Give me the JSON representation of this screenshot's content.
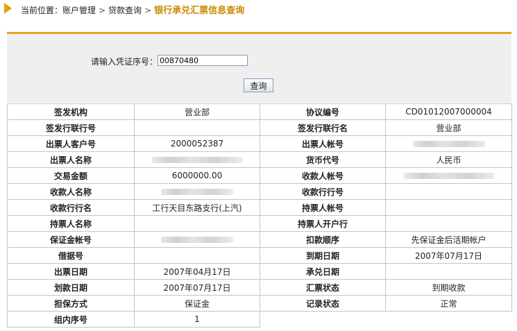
{
  "breadcrumb": {
    "prefix": "当前位置：",
    "items": [
      "账户管理",
      "贷款查询"
    ],
    "current": "银行承兑汇票信息查询",
    "separator": ">"
  },
  "search": {
    "label": "请输入凭证序号：",
    "value": "00870480",
    "button": "查询"
  },
  "rows": [
    {
      "k1": "签发机构",
      "v1": "营业部",
      "k2": "协议编号",
      "v2": "CD01012007000004"
    },
    {
      "k1": "签发行联行号",
      "v1": "",
      "k2": "签发行联行名",
      "v2": "营业部"
    },
    {
      "k1": "出票人客户号",
      "v1": "2000052387",
      "k2": "出票人帐号",
      "v2": ""
    },
    {
      "k1": "出票人名称",
      "v1": "",
      "k2": "货币代号",
      "v2": "人民币"
    },
    {
      "k1": "交易金额",
      "v1": "6000000.00",
      "k2": "收款人帐号",
      "v2": ""
    },
    {
      "k1": "收款人名称",
      "v1": "",
      "k2": "收款行行号",
      "v2": ""
    },
    {
      "k1": "收款行行名",
      "v1": "工行天目东路支行(上汽)",
      "k2": "持票人帐号",
      "v2": ""
    },
    {
      "k1": "持票人名称",
      "v1": "",
      "k2": "持票人开户行",
      "v2": ""
    },
    {
      "k1": "保证金帐号",
      "v1": "",
      "k2": "扣款顺序",
      "v2": "先保证金后活期帐户"
    },
    {
      "k1": "借据号",
      "v1": "",
      "k2": "到期日期",
      "v2": "2007年07月17日"
    },
    {
      "k1": "出票日期",
      "v1": "2007年04月17日",
      "k2": "承兑日期",
      "v2": ""
    },
    {
      "k1": "划款日期",
      "v1": "2007年07月17日",
      "k2": "汇票状态",
      "v2": "到期收款"
    },
    {
      "k1": "担保方式",
      "v1": "保证金",
      "k2": "记录状态",
      "v2": "正常"
    },
    {
      "k1": "组内序号",
      "v1": "1"
    }
  ],
  "colors": {
    "accent": "#e5a421",
    "breadcrumb_current": "#cc8a00",
    "panel_bg": "#efefef",
    "table_border": "#c4c4c4"
  }
}
